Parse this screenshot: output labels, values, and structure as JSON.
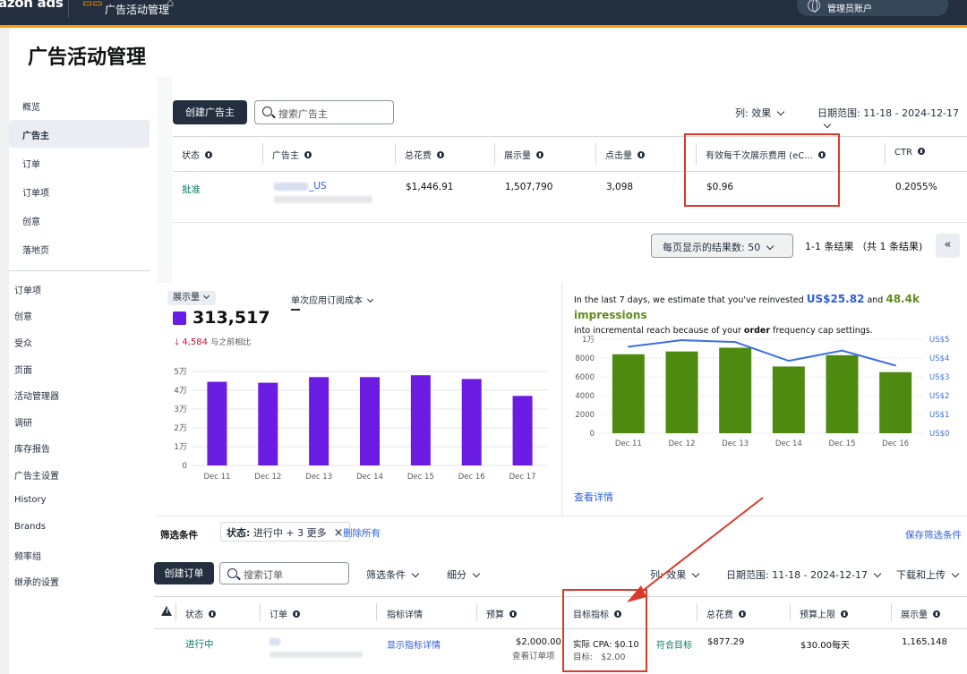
{
  "topbar": {
    "brand": "azon ads",
    "title": "广告活动管理",
    "account": "管理员账户"
  },
  "page": {
    "title": "广告活动管理"
  },
  "sidebar": {
    "items": [
      "概览",
      "广告主",
      "订单",
      "订单项",
      "创意",
      "落地页"
    ],
    "active": "广告主",
    "items2": [
      "订单项",
      "创意",
      "受众",
      "页面",
      "活动管理器",
      "调研",
      "库存报告",
      "广告主设置",
      "History",
      "Brands",
      "频率组",
      "继承的设置"
    ]
  },
  "toolbar": {
    "create_advertiser": "创建广告主",
    "search_placeholder": "搜索广告主",
    "columns": "列: 效果",
    "date_range": "日期范围: 11-18 - 2024-12-17"
  },
  "advertiser_table": {
    "headers": [
      "状态",
      "广告主",
      "总花费",
      "展示量",
      "点击量",
      "有效每千次展示费用 (eC...",
      "CTR"
    ],
    "row": {
      "status": "批准",
      "advertiser": "_US",
      "spend": "$1,446.91",
      "impressions": "1,507,790",
      "clicks": "3,098",
      "ecpm": "$0.96",
      "ctr": "0.2055%"
    }
  },
  "pagination": {
    "per_page": "每页显示的结果数: 50",
    "summary": "1-1 条结果 （共 1 条结果)",
    "collapse": "«"
  },
  "metric_card": {
    "metric_select": "展示量",
    "value": "313,517",
    "delta": "4,584",
    "delta_text": "与之前相比",
    "cost_label": "单次应用订阅成本",
    "cost_value": "—"
  },
  "chart_data": [
    {
      "type": "bar",
      "categories": [
        "Dec 11",
        "Dec 12",
        "Dec 13",
        "Dec 14",
        "Dec 15",
        "Dec 16",
        "Dec 17"
      ],
      "series": [
        {
          "values": [
            44500,
            44000,
            47000,
            47000,
            48000,
            46000,
            37000
          ]
        }
      ],
      "ylim": [
        0,
        50000
      ],
      "yticks": [
        "0",
        "1万",
        "2万",
        "3万",
        "4万",
        "5万"
      ],
      "grid": true
    },
    {
      "type": "bar",
      "categories": [
        "Dec 11",
        "Dec 12",
        "Dec 13",
        "Dec 14",
        "Dec 15",
        "Dec 16"
      ],
      "series": [
        {
          "values": [
            8400,
            8700,
            9100,
            7100,
            8300,
            6500
          ]
        },
        {
          "values": [
            4.6,
            4.95,
            4.85,
            3.85,
            4.4,
            3.6
          ]
        }
      ],
      "ylim": [
        0,
        10000
      ],
      "yticks": [
        "0",
        "2000",
        "4000",
        "6000",
        "8000",
        "1万"
      ],
      "y2lim": [
        0,
        5
      ],
      "y2ticks": [
        "US$0",
        "US$1",
        "US$2",
        "US$3",
        "US$4",
        "US$5"
      ],
      "grid": true
    }
  ],
  "estimate": {
    "part1": "In the last 7 days, we estimate that you've reinvested",
    "amount": "US$25.82",
    "and": "and",
    "impressions": "48.4k impressions",
    "part2": "into incremental reach because of your",
    "bold": "order",
    "part3": "frequency cap settings."
  },
  "details_link": "查看详情",
  "filters": {
    "label": "筛选条件",
    "chip_key": "状态:",
    "chip_value": "进行中 + 3 更多",
    "remove_all": "删除所有",
    "save": "保存筛选条件"
  },
  "orders_toolbar": {
    "create_order": "创建订单",
    "search_placeholder": "搜索订单",
    "filter": "筛选条件",
    "breakdown": "细分",
    "columns": "列: 效果",
    "date_range": "日期范围: 11-18 - 2024-12-17",
    "download": "下载和上传"
  },
  "orders_table": {
    "headers": [
      "状态",
      "订单",
      "指标详情",
      "预算",
      "目标指标",
      "总花费",
      "预算上限",
      "展示量"
    ],
    "row": {
      "status": "进行中",
      "details_link": "显示指标详情",
      "budget": "$2,000.00",
      "budget_sub": "查看订单项",
      "actual_cpa": "实际 CPA: $0.10",
      "target": "目标:   $2.00",
      "meets": "符合目标",
      "spend": "$877.29",
      "cap": "$30.00每天",
      "impressions": "1,165,148"
    }
  },
  "colors": {
    "purple_bar": "#6a1ce2",
    "green_bar": "#4f8a10",
    "line_blue": "#3b6fe0",
    "highlight_red": "#d93a2a"
  }
}
